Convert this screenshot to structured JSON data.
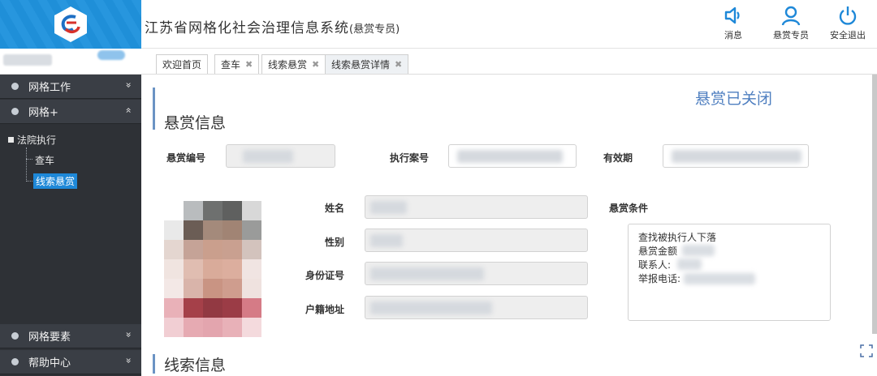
{
  "header": {
    "title": "江苏省网格化社会治理信息系统",
    "subtitle": "(悬赏专员)",
    "buttons": [
      {
        "label": "消息",
        "icon": "speaker-icon"
      },
      {
        "label": "悬赏专员",
        "icon": "user-icon"
      },
      {
        "label": "安全退出",
        "icon": "power-icon"
      }
    ]
  },
  "sidebar": {
    "menu": [
      {
        "label": "网格工作",
        "arrow": "»"
      },
      {
        "label": "网格+",
        "arrow": "«"
      },
      {
        "label": "网格要素",
        "arrow": "»"
      },
      {
        "label": "帮助中心",
        "arrow": "»"
      }
    ],
    "tree": {
      "root": "法院执行",
      "children": [
        "查车",
        "线索悬赏"
      ]
    }
  },
  "tabs": [
    {
      "label": "欢迎首页",
      "closable": false
    },
    {
      "label": "查车",
      "closable": true
    },
    {
      "label": "线索悬赏",
      "closable": true
    },
    {
      "label": "线索悬赏详情",
      "closable": true
    }
  ],
  "main": {
    "status": "悬赏已关闭",
    "section1_title": "悬赏信息",
    "section2_title": "线索信息",
    "labels": {
      "reward_no": "悬赏编号",
      "case_no": "执行案号",
      "valid_period": "有效期",
      "name": "姓名",
      "gender": "性别",
      "id_no": "身份证号",
      "address": "户籍地址",
      "conditions": "悬赏条件"
    },
    "conditions_lines": [
      "查找被执行人下落",
      "悬赏金额",
      "联系人:",
      "举报电话:"
    ]
  },
  "colors": {
    "accent": "#1e88d8",
    "sidebar_bg": "#2e3136",
    "status": "#4f7fc0"
  }
}
